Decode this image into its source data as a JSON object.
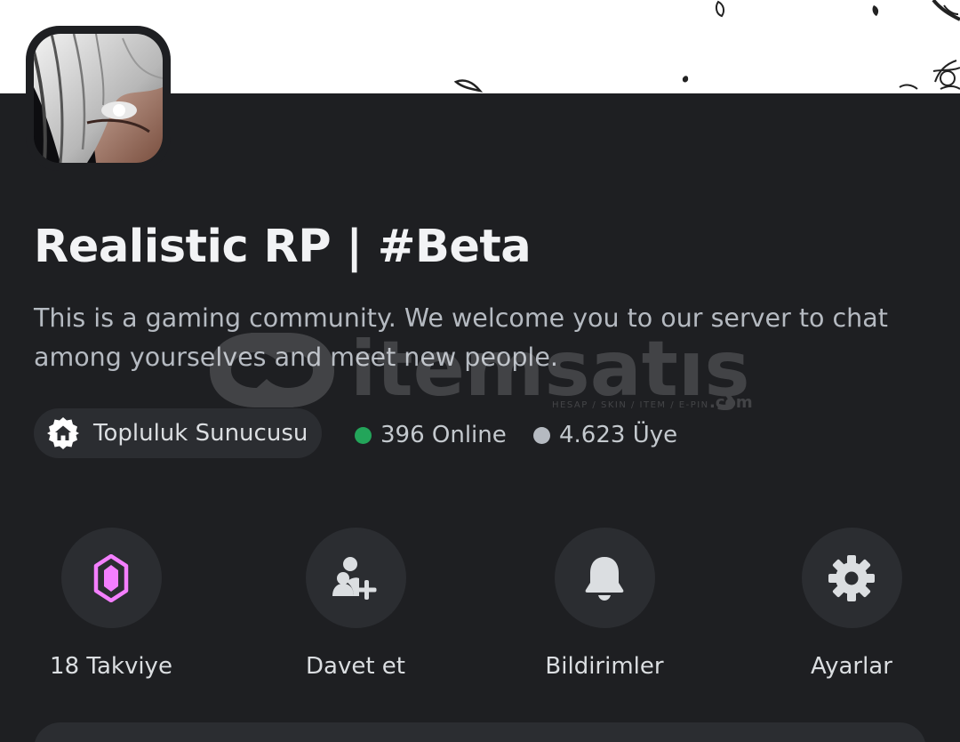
{
  "server": {
    "name": "Realistic RP | #Beta",
    "description": "This is a gaming community. We welcome you to our server to chat among yourselves and meet new people."
  },
  "badges": {
    "community_label": "Topluluk Sunucusu",
    "online_text": "396 Online",
    "members_text": "4.623 Üye"
  },
  "actions": [
    {
      "label": "18 Takviye",
      "icon": "boost-gem-icon"
    },
    {
      "label": "Davet et",
      "icon": "add-friend-icon"
    },
    {
      "label": "Bildirimler",
      "icon": "bell-icon"
    },
    {
      "label": "Ayarlar",
      "icon": "gear-icon"
    }
  ],
  "watermark": {
    "brand": "itemsatış",
    "tagline": "HESAP / SKIN / ITEM / E-PIN",
    "suffix": ".com"
  },
  "colors": {
    "background": "#1e1f22",
    "surface": "#2b2d31",
    "online": "#23a55a",
    "offline": "#b5bac1",
    "boost": "#f47fff"
  }
}
